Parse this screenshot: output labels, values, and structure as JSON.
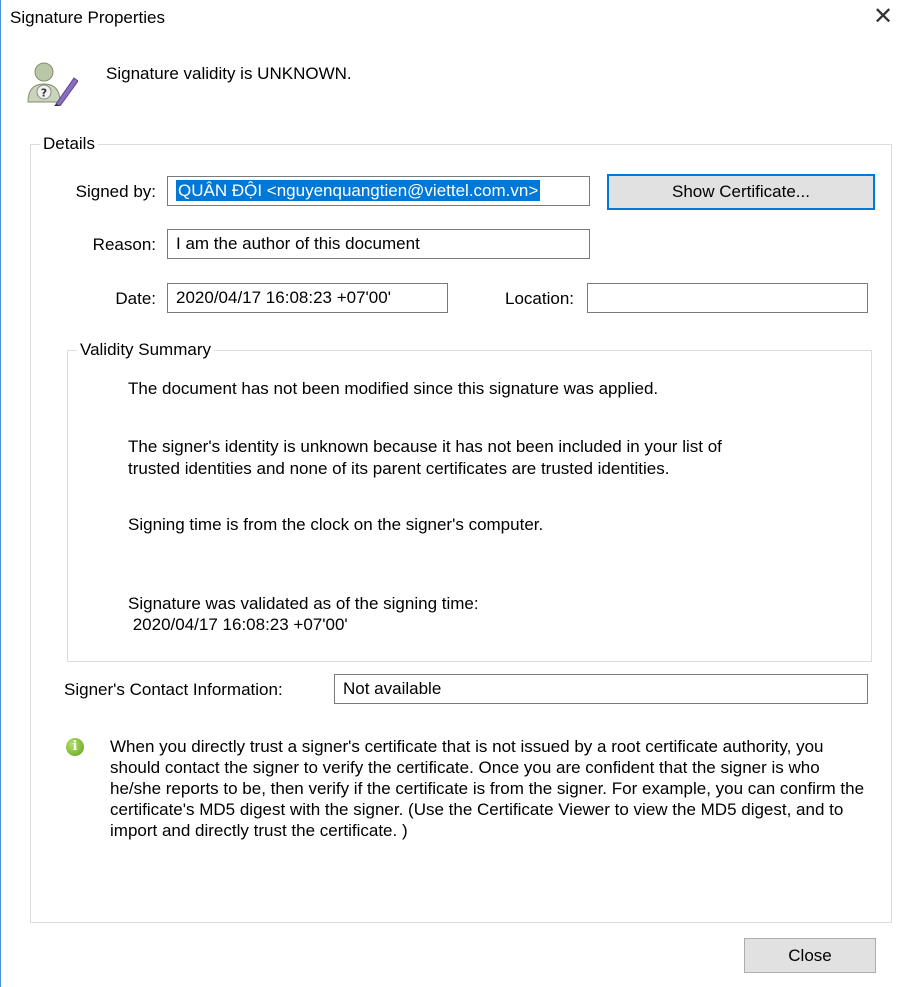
{
  "window": {
    "title": "Signature Properties",
    "close_glyph": "✕"
  },
  "status": {
    "icon": "signature-unknown-icon",
    "text": "Signature validity is UNKNOWN."
  },
  "details": {
    "legend": "Details",
    "signed_by_label": "Signed by:",
    "signed_by_value": "QUÂN ĐỘI <nguyenquangtien@viettel.com.vn>",
    "show_certificate_label": "Show Certificate...",
    "reason_label": "Reason:",
    "reason_value": "I am the author of this document",
    "date_label": "Date:",
    "date_value": "2020/04/17 16:08:23 +07'00'",
    "location_label": "Location:",
    "location_value": ""
  },
  "validity": {
    "legend": "Validity Summary",
    "line1": "The document has not been modified since this signature was applied.",
    "line2a": "The signer's identity is unknown because it has not been included in your list of",
    "line2b": "trusted identities and none of its parent certificates are trusted identities.",
    "line3": "Signing time is from the clock on the signer's computer.",
    "line4a": "Signature was validated as of the signing time:",
    "line4b": " 2020/04/17 16:08:23 +07'00'"
  },
  "contact": {
    "label": "Signer's Contact Information:",
    "value": "Not available"
  },
  "info": {
    "icon": "info-icon",
    "text": "When you directly trust a signer's certificate that is not issued by a root certificate authority, you should contact the signer to verify the certificate. Once you are confident that the signer is who he/she reports to be, then verify if the certificate is from the signer. For example, you can confirm the certificate's MD5 digest with the signer. (Use the Certificate Viewer to view the MD5 digest, and to import and directly trust the certificate. )"
  },
  "footer": {
    "close_label": "Close"
  }
}
